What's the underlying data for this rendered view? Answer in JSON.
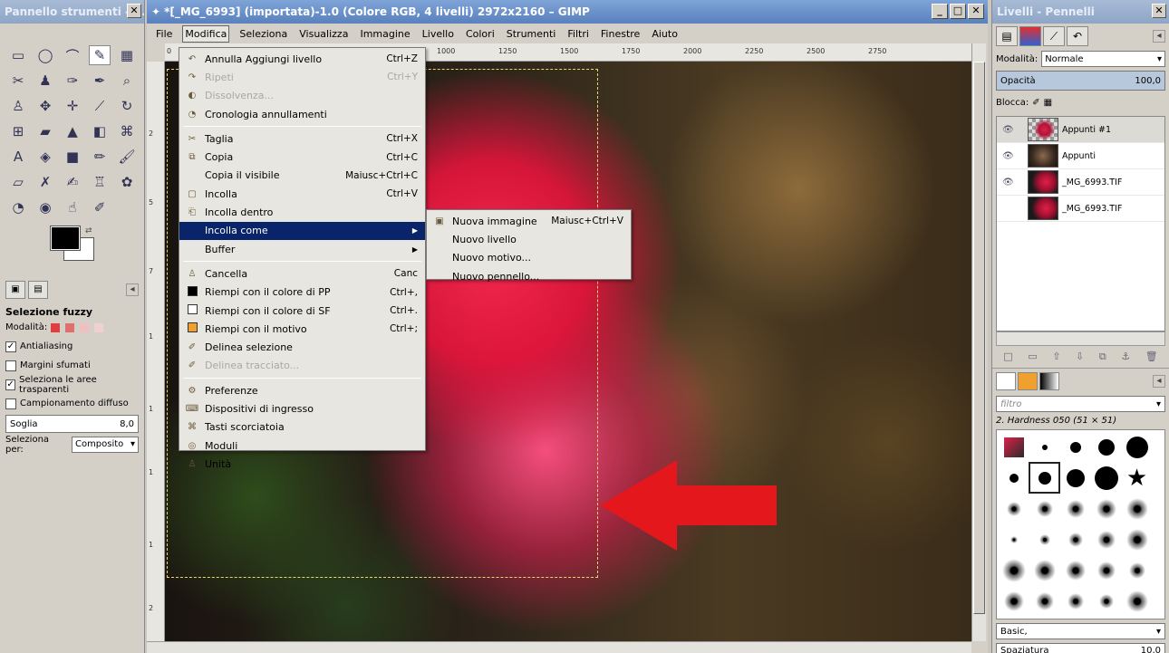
{
  "toolbox": {
    "title": "Pannello strumenti - ...",
    "close_glyph": "✕",
    "tools": [
      {
        "icon": "rect-select-icon",
        "glyph": "▭"
      },
      {
        "icon": "ellipse-select-icon",
        "glyph": "◯"
      },
      {
        "icon": "free-select-icon",
        "glyph": "⌒"
      },
      {
        "icon": "fuzzy-select-icon",
        "glyph": "✎"
      },
      {
        "icon": "color-select-icon",
        "glyph": "▦"
      },
      {
        "icon": "scissors-icon",
        "glyph": "✂"
      },
      {
        "icon": "foreground-select-icon",
        "glyph": "♟"
      },
      {
        "icon": "paths-icon",
        "glyph": "✑"
      },
      {
        "icon": "color-picker-icon",
        "glyph": "✒"
      },
      {
        "icon": "zoom-icon",
        "glyph": "⌕"
      },
      {
        "icon": "measure-icon",
        "glyph": "♙"
      },
      {
        "icon": "move-icon",
        "glyph": "✥"
      },
      {
        "icon": "align-icon",
        "glyph": "✛"
      },
      {
        "icon": "crop-icon",
        "glyph": "⟋"
      },
      {
        "icon": "rotate-icon",
        "glyph": "↻"
      },
      {
        "icon": "scale-icon",
        "glyph": "⊞"
      },
      {
        "icon": "shear-icon",
        "glyph": "▰"
      },
      {
        "icon": "perspective-icon",
        "glyph": "▲"
      },
      {
        "icon": "flip-icon",
        "glyph": "◧"
      },
      {
        "icon": "cage-icon",
        "glyph": "⌘"
      },
      {
        "icon": "text-icon",
        "glyph": "A"
      },
      {
        "icon": "bucket-fill-icon",
        "glyph": "◈"
      },
      {
        "icon": "blend-icon",
        "glyph": "■"
      },
      {
        "icon": "pencil-icon",
        "glyph": "✏"
      },
      {
        "icon": "paintbrush-icon",
        "glyph": "🖌"
      },
      {
        "icon": "eraser-icon",
        "glyph": "▱"
      },
      {
        "icon": "airbrush-icon",
        "glyph": "✗"
      },
      {
        "icon": "ink-icon",
        "glyph": "✍"
      },
      {
        "icon": "clone-icon",
        "glyph": "♖"
      },
      {
        "icon": "heal-icon",
        "glyph": "✿"
      },
      {
        "icon": "perspective-clone-icon",
        "glyph": "◔"
      },
      {
        "icon": "blur-icon",
        "glyph": "◉"
      },
      {
        "icon": "smudge-icon",
        "glyph": "☝"
      },
      {
        "icon": "dodge-burn-icon",
        "glyph": "✐"
      }
    ],
    "swap_glyph": "⇄",
    "options_title": "Selezione fuzzy",
    "mode_label": "Modalità:",
    "antialiasing": "Antialiasing",
    "feather_edges": "Margini sfumati",
    "select_transparent": "Seleziona le aree trasparenti",
    "sample_merged": "Campionamento diffuso",
    "threshold_label": "Soglia",
    "threshold_value": "8,0",
    "select_by_label": "Seleziona per:",
    "select_by_value": "Composito",
    "tab_menu_glyph": "◂"
  },
  "mainwin": {
    "title": "*[_MG_6993] (importata)-1.0 (Colore RGB, 4 livelli) 2972x2160 – GIMP",
    "minimize_glyph": "_",
    "maximize_glyph": "□",
    "close_glyph": "✕",
    "menubar": [
      "File",
      "Modifica",
      "Seleziona",
      "Visualizza",
      "Immagine",
      "Livello",
      "Colori",
      "Strumenti",
      "Filtri",
      "Finestre",
      "Aiuto"
    ],
    "ruler_h": [
      "0",
      "1000",
      "1250",
      "1500",
      "1750",
      "2000",
      "2250",
      "2500",
      "2750"
    ],
    "ruler_v": [
      "2",
      "5",
      "7",
      "1",
      "1",
      "1",
      "1",
      "2"
    ]
  },
  "modifica_menu": {
    "items": [
      {
        "label": "Annulla Aggiungi livello",
        "accel": "Ctrl+Z",
        "icon": "undo-icon",
        "glyph": "↶"
      },
      {
        "label": "Ripeti",
        "accel": "Ctrl+Y",
        "icon": "redo-icon",
        "glyph": "↷",
        "disabled": true
      },
      {
        "label": "Dissolvenza...",
        "accel": "",
        "icon": "fade-icon",
        "glyph": "◐",
        "disabled": true
      },
      {
        "label": "Cronologia annullamenti",
        "accel": "",
        "icon": "undo-history-icon",
        "glyph": "◔",
        "sep_after": true
      },
      {
        "label": "Taglia",
        "accel": "Ctrl+X",
        "icon": "cut-icon",
        "glyph": "✂"
      },
      {
        "label": "Copia",
        "accel": "Ctrl+C",
        "icon": "copy-icon",
        "glyph": "⧉"
      },
      {
        "label": "Copia il visibile",
        "accel": "Maiusc+Ctrl+C",
        "icon": "copy-visible-icon",
        "glyph": ""
      },
      {
        "label": "Incolla",
        "accel": "Ctrl+V",
        "icon": "paste-icon",
        "glyph": "▢"
      },
      {
        "label": "Incolla dentro",
        "accel": "",
        "icon": "paste-into-icon",
        "glyph": "⎗"
      },
      {
        "label": "Incolla come",
        "accel": "",
        "icon": "paste-as-icon",
        "glyph": "",
        "submenu": true,
        "highlight": true
      },
      {
        "label": "Buffer",
        "accel": "",
        "icon": "buffer-icon",
        "glyph": "",
        "submenu": true,
        "sep_after": true
      },
      {
        "label": "Cancella",
        "accel": "Canc",
        "icon": "clear-icon",
        "glyph": "♙"
      },
      {
        "label": "Riempi con il colore di PP",
        "accel": "Ctrl+,",
        "icon": "fill-fg-icon",
        "glyph": "",
        "swatch": "#000000"
      },
      {
        "label": "Riempi con il colore di SF",
        "accel": "Ctrl+.",
        "icon": "fill-bg-icon",
        "glyph": "",
        "swatch": "#ffffff"
      },
      {
        "label": "Riempi con il motivo",
        "accel": "Ctrl+;",
        "icon": "fill-pattern-icon",
        "glyph": "",
        "swatch": "#f0a030"
      },
      {
        "label": "Delinea selezione",
        "accel": "",
        "icon": "stroke-selection-icon",
        "glyph": "✐"
      },
      {
        "label": "Delinea tracciato...",
        "accel": "",
        "icon": "stroke-path-icon",
        "glyph": "✐",
        "disabled": true,
        "sep_after": true
      },
      {
        "label": "Preferenze",
        "accel": "",
        "icon": "preferences-icon",
        "glyph": "⚙"
      },
      {
        "label": "Dispositivi di ingresso",
        "accel": "",
        "icon": "input-devices-icon",
        "glyph": "⌨"
      },
      {
        "label": "Tasti scorciatoia",
        "accel": "",
        "icon": "shortcuts-icon",
        "glyph": "⌘"
      },
      {
        "label": "Moduli",
        "accel": "",
        "icon": "modules-icon",
        "glyph": "◎"
      },
      {
        "label": "Unità",
        "accel": "",
        "icon": "units-icon",
        "glyph": "♙"
      }
    ],
    "submenu_glyph": "▶"
  },
  "incolla_come_menu": {
    "items": [
      {
        "label": "Nuova immagine",
        "accel": "Maiusc+Ctrl+V",
        "icon": "new-image-icon",
        "glyph": "▣"
      },
      {
        "label": "Nuovo livello",
        "accel": "",
        "icon": "",
        "glyph": ""
      },
      {
        "label": "Nuovo motivo...",
        "accel": "",
        "icon": "",
        "glyph": ""
      },
      {
        "label": "Nuovo pennello...",
        "accel": "",
        "icon": "",
        "glyph": ""
      }
    ]
  },
  "dock": {
    "title": "Livelli - Pennelli",
    "close_glyph": "✕",
    "mode_label": "Modalità:",
    "mode_value": "Normale",
    "opacity_label": "Opacità",
    "opacity_value": "100,0",
    "lock_label": "Blocca:",
    "eye_glyph": "👁",
    "layers": [
      {
        "name": "Appunti #1",
        "visible": true,
        "thumb": "check",
        "selected": true
      },
      {
        "name": "Appunti",
        "visible": true,
        "thumb": "dark"
      },
      {
        "name": "_MG_6993.TIF",
        "visible": true,
        "thumb": "flower"
      },
      {
        "name": "_MG_6993.TIF",
        "visible": false,
        "thumb": "flower"
      }
    ],
    "layer_buttons": [
      "□",
      "▭",
      "⇧",
      "⇩",
      "⧉",
      "⚓",
      "🗑"
    ],
    "filter_placeholder": "filtro",
    "brush_name": "2. Hardness 050 (51 × 51)",
    "brush_set": "Basic,",
    "spacing_label": "Spaziatura",
    "spacing_value": "10,0"
  },
  "colors": {
    "accent": "#0a246a",
    "arrow": "#e3171c",
    "selection": "#e8d86a"
  }
}
